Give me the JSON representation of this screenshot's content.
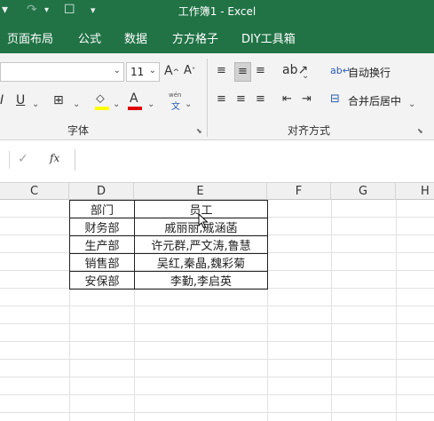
{
  "titlebar": {
    "title": "工作簿1  -  Excel",
    "undo_icon": "undo-icon",
    "redo_icon": "redo-icon",
    "touch_icon": "touch-mode-icon",
    "customize_icon": "customize-qat-icon"
  },
  "tabs": [
    "页面布局",
    "公式",
    "数据",
    "方方格子",
    "DIY工具箱"
  ],
  "ribbon": {
    "font_size": "11",
    "increase_font_label": "A",
    "decrease_font_label": "A",
    "underline_label": "U",
    "italic_label": "I",
    "phonetic_label": "wén",
    "phonetic_sub": "文",
    "font_color_label": "A",
    "font_group_label": "字体",
    "align_group_label": "对齐方式",
    "wrap_text_label": "自动换行",
    "merge_center_label": "合并后居中",
    "highlight_color": "#ffff00",
    "font_color": "#e00000"
  },
  "formula_bar": {
    "fx_label": "fx",
    "value": ""
  },
  "columns": [
    "C",
    "D",
    "E",
    "F",
    "G",
    "H"
  ],
  "table": {
    "header": [
      "部门",
      "员工"
    ],
    "rows": [
      [
        "财务部",
        "戚丽丽,戚涵菡"
      ],
      [
        "生产部",
        "许元群,严文涛,鲁慧"
      ],
      [
        "销售部",
        "吴红,秦晶,魏彩菊"
      ],
      [
        "安保部",
        "李勤,李启英"
      ]
    ]
  },
  "colors": {
    "brand": "#217346"
  }
}
